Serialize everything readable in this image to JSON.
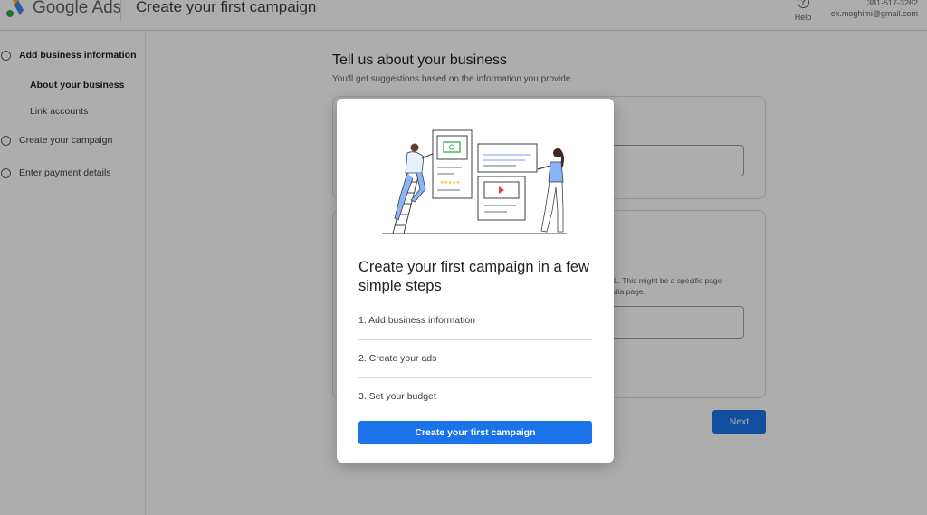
{
  "header": {
    "brand": "Google Ads",
    "title": "Create your first campaign",
    "help_label": "Help",
    "account_phone": "381-517-3262",
    "account_email": "ek.moghimi@gmail.com"
  },
  "sidebar": {
    "steps": [
      {
        "label": "Add business information",
        "active": true
      },
      {
        "label": "Create your campaign",
        "active": false
      },
      {
        "label": "Enter payment details",
        "active": false
      }
    ],
    "substeps": [
      {
        "label": "About your business",
        "active": true
      },
      {
        "label": "Link accounts",
        "active": false
      }
    ]
  },
  "main": {
    "title": "Tell us about your business",
    "subtitle": "You'll get suggestions based on the information you provide",
    "hint_line1": "L. This might be a specific page",
    "hint_line2": "dia page.",
    "next_label": "Next"
  },
  "modal": {
    "title": "Create your first campaign in a few simple steps",
    "steps": [
      "1. Add business information",
      "2. Create your ads",
      "3. Set your budget"
    ],
    "cta_label": "Create your first campaign"
  },
  "colors": {
    "accent": "#1a73e8",
    "logo_yellow": "#fbbc04",
    "logo_blue": "#4285f4",
    "logo_green": "#34a853"
  }
}
